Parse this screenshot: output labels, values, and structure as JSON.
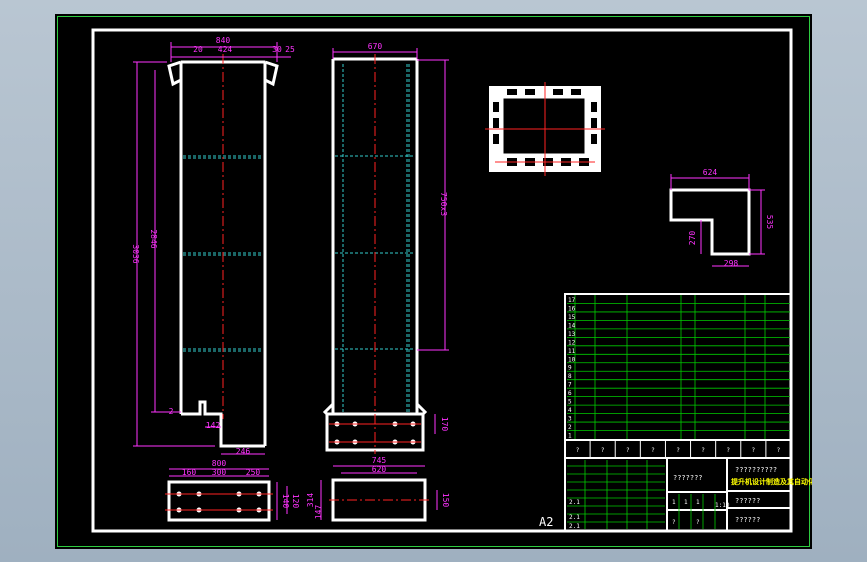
{
  "colors": {
    "sheet_frame": "#ffffff",
    "outer_border": "#2ecc40",
    "dimension": "#ff33ff",
    "centerline": "#ff2222",
    "hidden_line": "#33cccc",
    "table_grid": "#00cc00",
    "highlight_text": "#ffff00",
    "background": "#000000"
  },
  "front_view": {
    "dims": {
      "overall_width": "840",
      "left_rim": "20",
      "inner_width": "424",
      "right_rim": "30",
      "right_gap": "25",
      "total_height": "3036",
      "inner_height": "2846",
      "bottom_offset": "2",
      "outlet_width": "142",
      "base_width": "246"
    }
  },
  "side_view": {
    "dims": {
      "top_width": "670",
      "height_label": "750x3",
      "flange_height": "170"
    }
  },
  "bottom_left_view": {
    "dims": {
      "overall": "800",
      "seg1": "160",
      "seg2": "300",
      "seg3": "250",
      "h1": "140",
      "h2": "120"
    }
  },
  "bottom_mid_view": {
    "dims": {
      "outer": "745",
      "inner": "620",
      "height_left": "314",
      "height_inner": "147",
      "height_right": "150"
    }
  },
  "small_part": {
    "dims": {
      "top": "624",
      "right": "535",
      "left": "270",
      "bottom": "298"
    }
  },
  "paper_size": "A2",
  "parts_table": {
    "row_numbers": [
      "17",
      "16",
      "15",
      "14",
      "13",
      "12",
      "11",
      "10",
      "9",
      "8",
      "7",
      "6",
      "5",
      "4",
      "3",
      "2",
      "1"
    ]
  },
  "title_block": {
    "header_cells": [
      "?",
      "?",
      "?",
      "?",
      "?",
      "?",
      "?",
      "?",
      "?"
    ],
    "company_placeholder": "???????",
    "title_line1": "??????????",
    "title_line2": "提升机设计制造及其自动化",
    "drawing_no": "??????",
    "scale": "1:10",
    "sheet_cell": "??????",
    "small_cells": [
      "2.1",
      "2.1",
      "2.1",
      "1",
      "1",
      "1",
      "?",
      "?"
    ]
  }
}
